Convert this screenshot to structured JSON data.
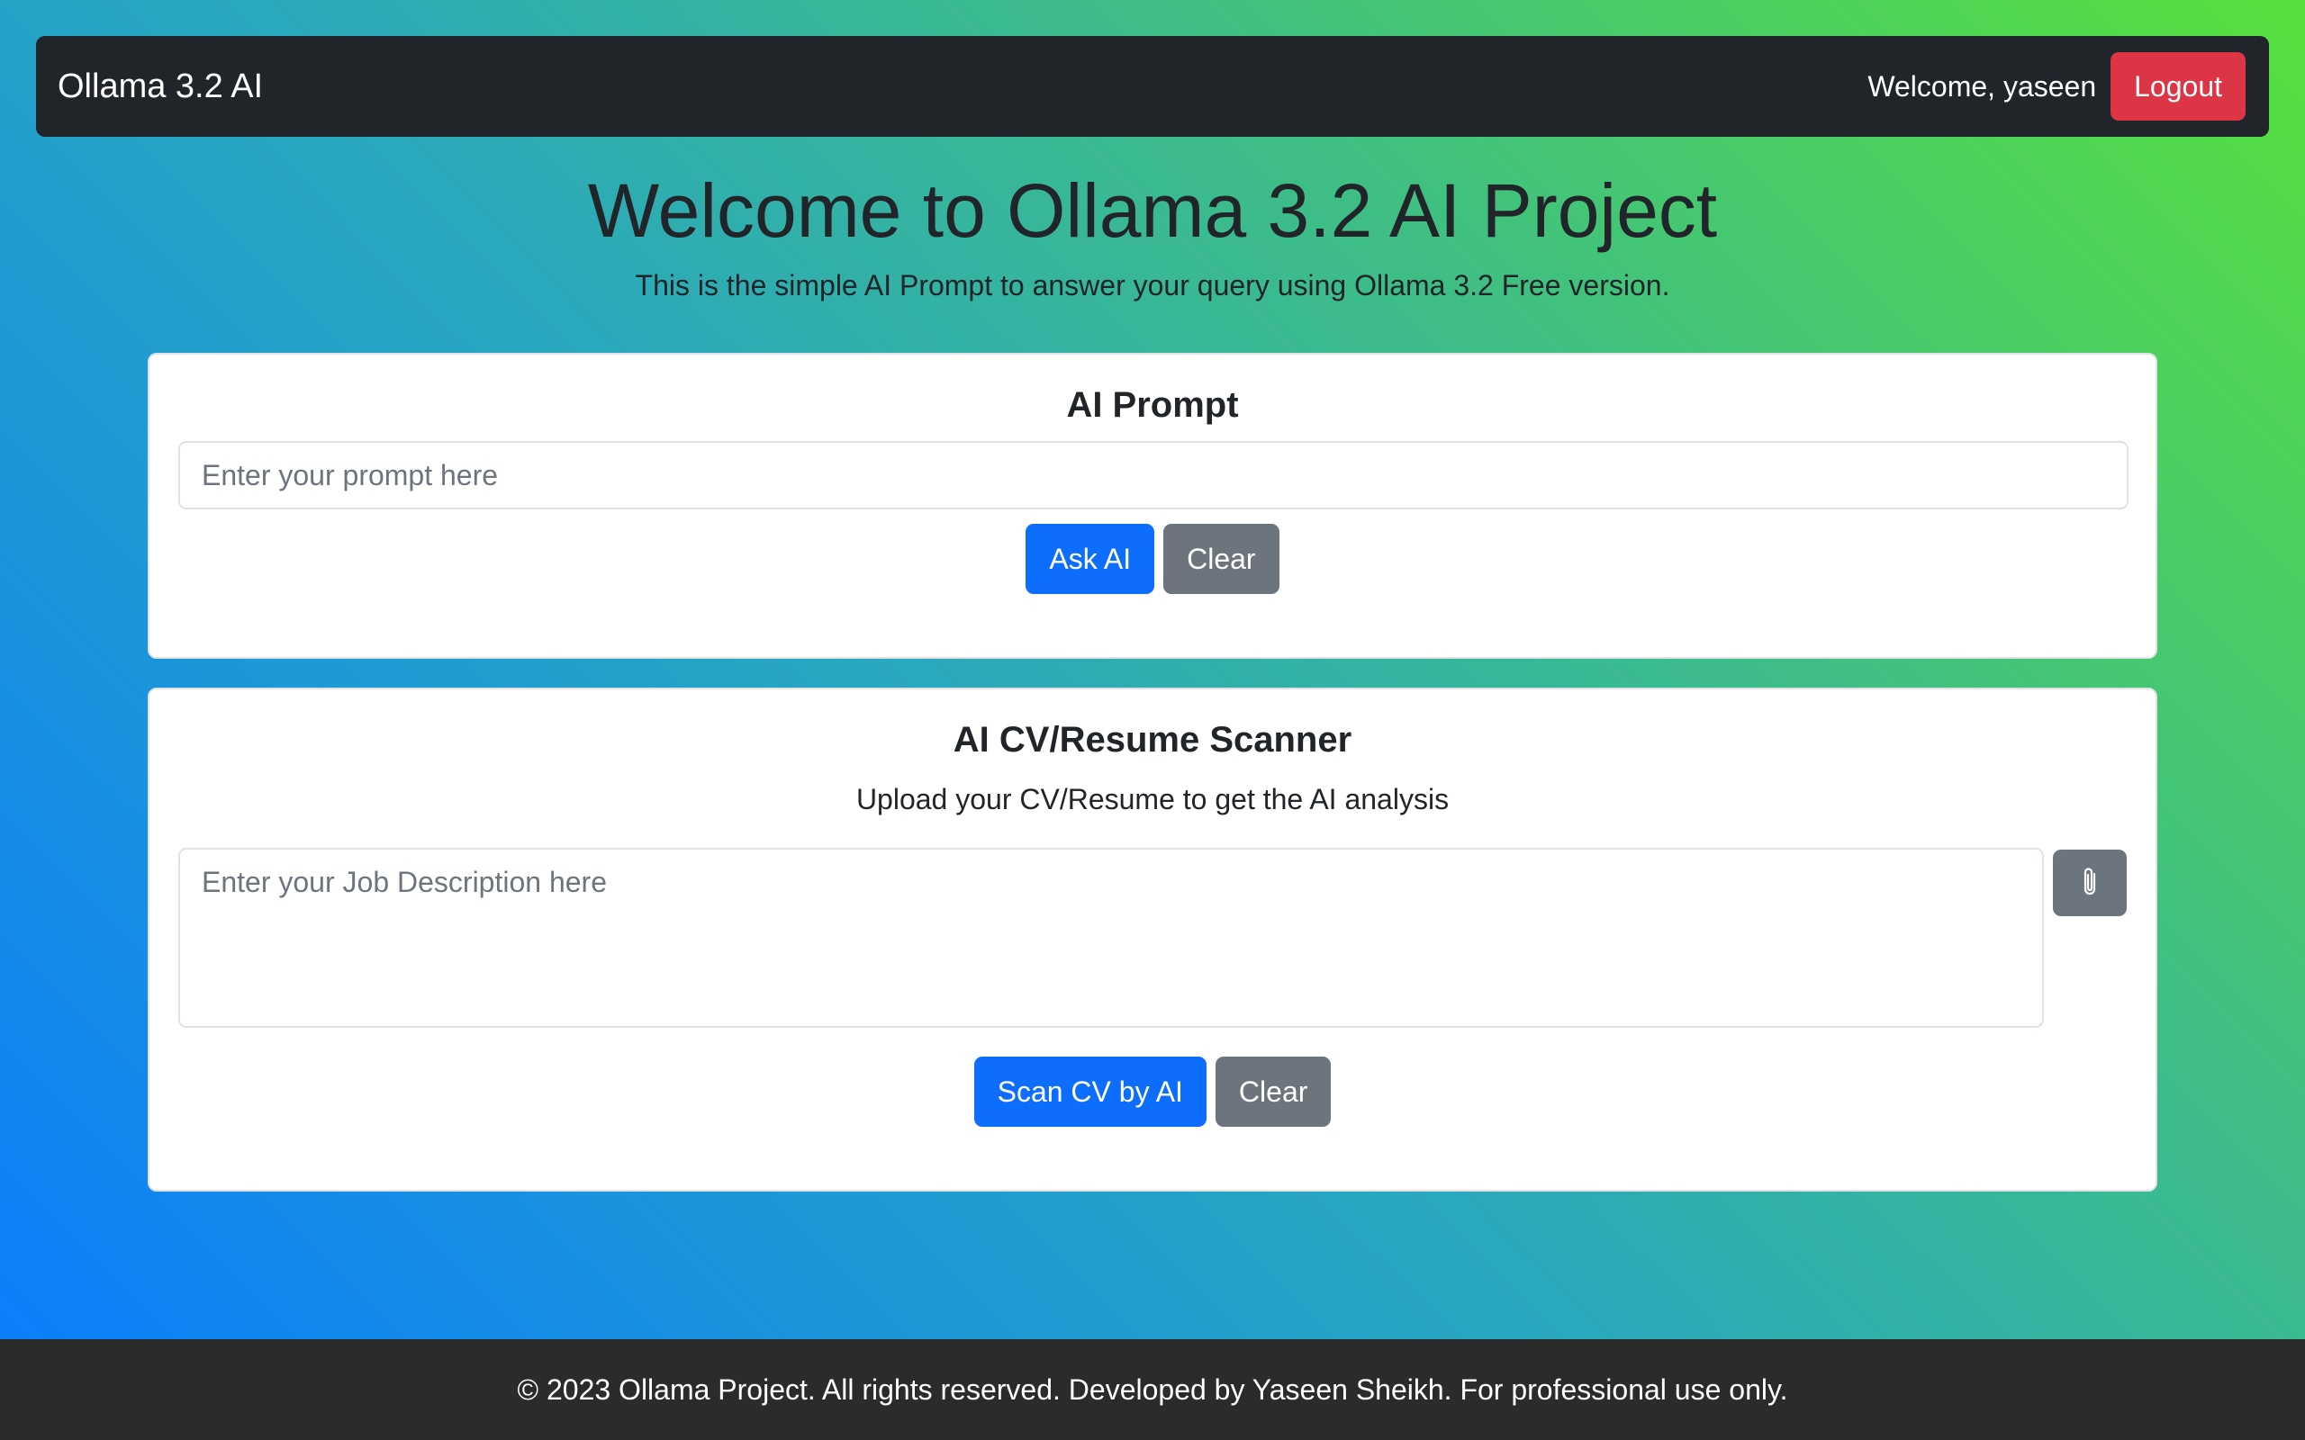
{
  "navbar": {
    "brand": "Ollama 3.2 AI",
    "welcome_text": "Welcome, yaseen",
    "logout_label": "Logout"
  },
  "hero": {
    "title": "Welcome to Ollama 3.2 AI Project",
    "subtitle": "This is the simple AI Prompt to answer your query using Ollama 3.2 Free version."
  },
  "prompt_card": {
    "title": "AI Prompt",
    "input_placeholder": "Enter your prompt here",
    "input_value": "",
    "ask_label": "Ask AI",
    "clear_label": "Clear"
  },
  "cv_card": {
    "title": "AI CV/Resume Scanner",
    "subtitle": "Upload your CV/Resume to get the AI analysis",
    "jd_placeholder": "Enter your Job Description here",
    "jd_value": "",
    "attach_icon": "paperclip-icon",
    "scan_label": "Scan CV by AI",
    "clear_label": "Clear"
  },
  "footer": {
    "text": "© 2023 Ollama Project. All rights reserved. Developed by Yaseen Sheikh. For professional use only."
  },
  "colors": {
    "primary": "#0d6efd",
    "secondary": "#6c757d",
    "danger": "#dc3545",
    "dark": "#212529",
    "gradient_start": "#0a7cff",
    "gradient_end": "#57e03c"
  }
}
